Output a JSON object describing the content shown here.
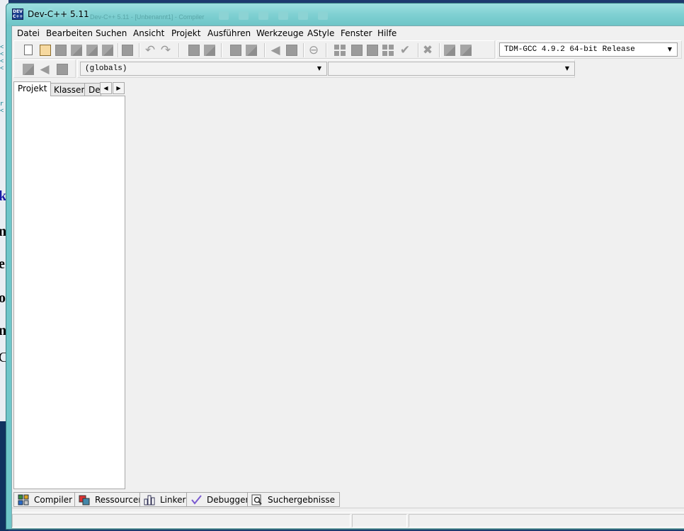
{
  "window": {
    "title": "Dev-C++ 5.11",
    "app_icon_text": "DEV C++",
    "ghost_title": "Dev-C++ 5.11 - [Unbenannt1] - Compiler"
  },
  "menu": [
    {
      "label": "Datei"
    },
    {
      "label": "Bearbeiten"
    },
    {
      "label": "Suchen"
    },
    {
      "label": "Ansicht"
    },
    {
      "label": "Projekt"
    },
    {
      "label": "Ausführen"
    },
    {
      "label": "Werkzeuge"
    },
    {
      "label": "AStyle"
    },
    {
      "label": "Fenster"
    },
    {
      "label": "Hilfe"
    }
  ],
  "toolbar": {
    "compiler_select": "TDM-GCC 4.9.2 64-bit Release",
    "scope_select": "(globals)",
    "member_select": ""
  },
  "left_panel": {
    "tabs": [
      {
        "label": "Projekt"
      },
      {
        "label": "Klassen"
      },
      {
        "label": "De"
      }
    ]
  },
  "bottom_tabs": [
    {
      "label": "Compiler",
      "icon": "grid-icon"
    },
    {
      "label": "Ressourcen",
      "icon": "resources-icon"
    },
    {
      "label": "Linker",
      "icon": "chart-icon"
    },
    {
      "label": "Debugger",
      "icon": "check-icon"
    },
    {
      "label": "Suchergebnisse",
      "icon": "search-icon"
    }
  ],
  "background_window": {
    "letters": [
      "k",
      "n",
      "e",
      "o",
      "n",
      "C"
    ]
  },
  "colors": {
    "titlebar": "#7fd0d2",
    "client_bg": "#f0f0f0",
    "desktop": "#1e3a6e"
  }
}
